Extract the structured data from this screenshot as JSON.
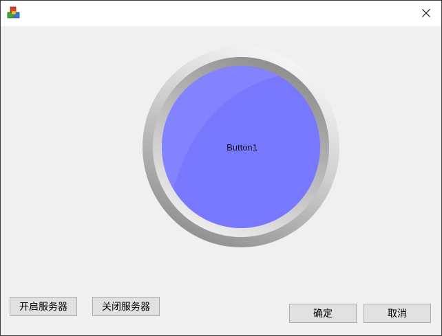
{
  "window": {
    "app_icon": "windows-app-icon",
    "close_icon": "close-icon"
  },
  "main": {
    "round_button_label": "Button1",
    "round_button_color": "#7878ff"
  },
  "buttons": {
    "start_server": "开启服务器",
    "stop_server": "关闭服务器",
    "ok": "确定",
    "cancel": "取消"
  }
}
